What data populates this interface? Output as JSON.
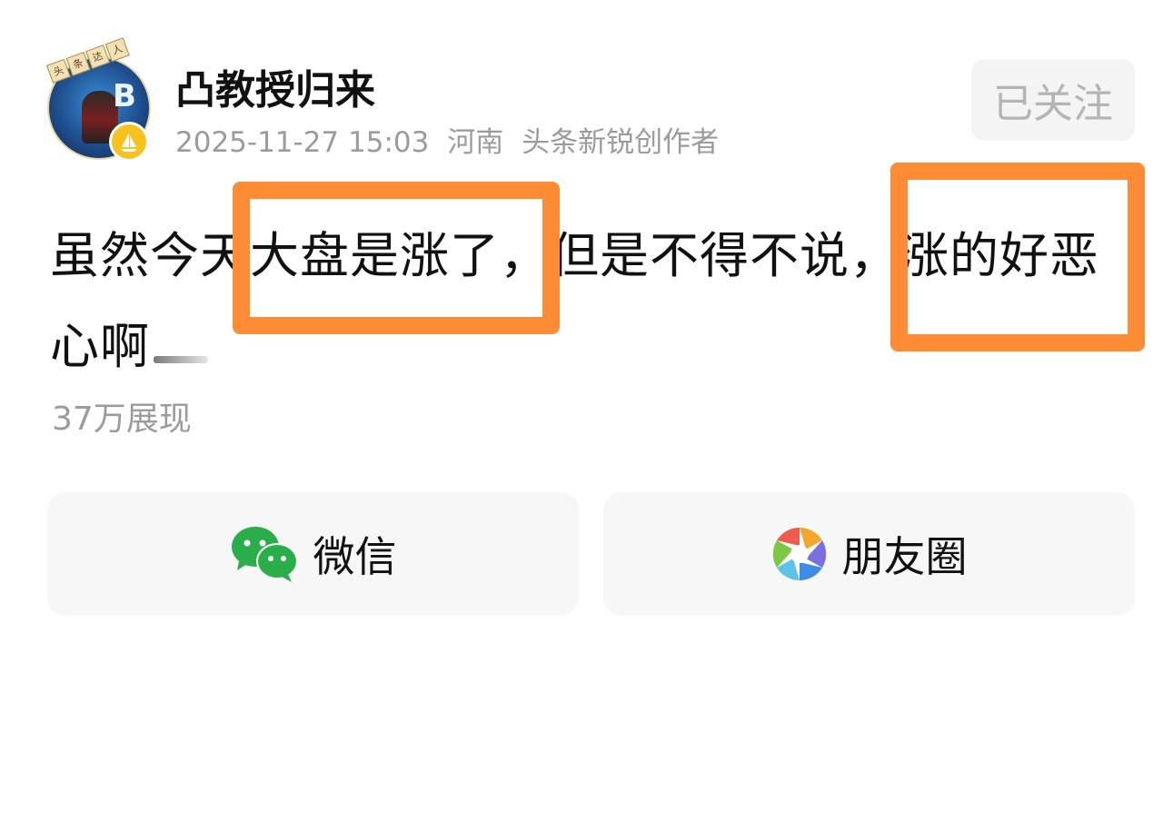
{
  "author": {
    "name": "凸教授归来",
    "avatar_sign": [
      "头",
      "条",
      "达",
      "人"
    ],
    "avatar_letters": "B",
    "badge_icon": "sailboat-icon"
  },
  "meta": {
    "datetime": "2025-11-27 15:03",
    "location": "河南",
    "creator_tag": "头条新锐创作者"
  },
  "follow_button": {
    "label": "已关注"
  },
  "post": {
    "segments": [
      "虽然今天",
      "大盘是涨了，",
      "但是不得不说，",
      "涨的好恶",
      "心啊"
    ],
    "highlight_color": "#ff8c35"
  },
  "views": {
    "label": "37万展现"
  },
  "share": {
    "wechat_label": "微信",
    "wechat_icon": "wechat-icon",
    "moments_label": "朋友圈",
    "moments_icon": "moments-aperture-icon",
    "wechat_color": "#2aae4a"
  }
}
